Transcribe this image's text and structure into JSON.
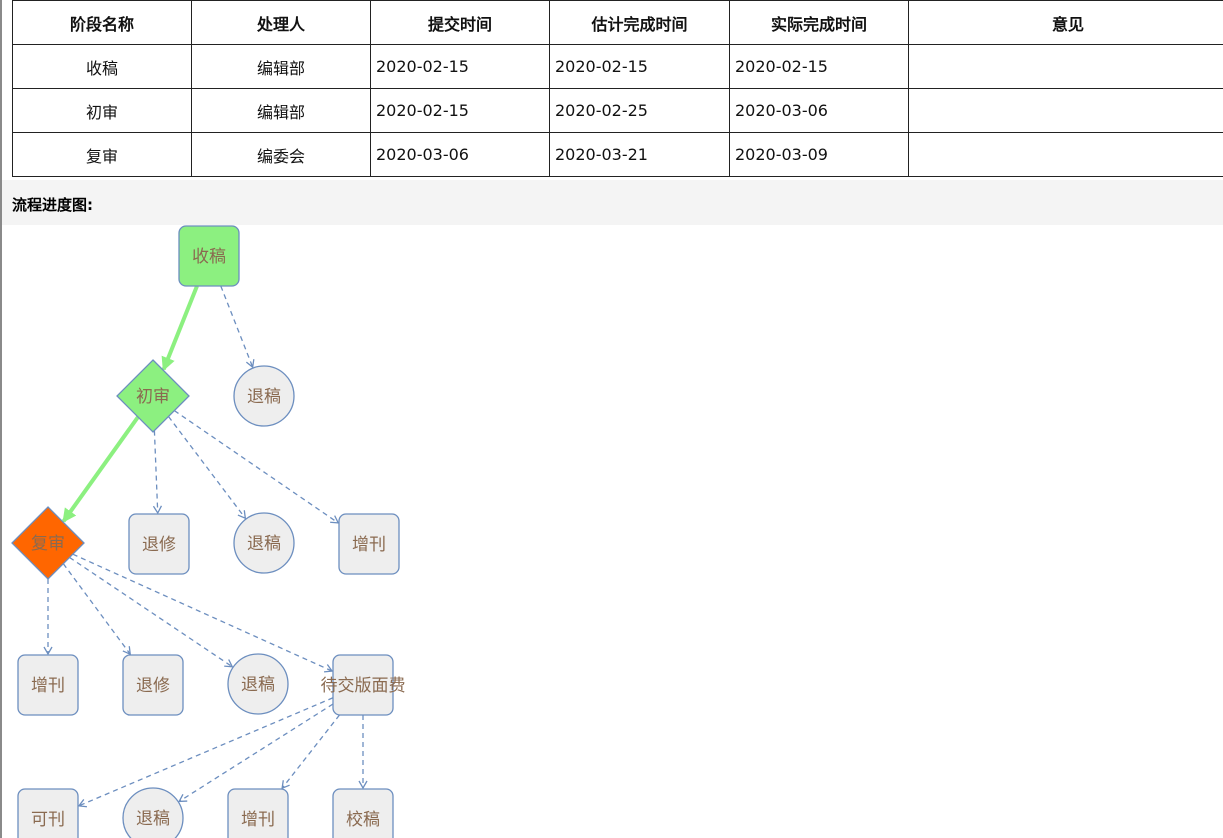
{
  "table": {
    "headers": [
      "阶段名称",
      "处理人",
      "提交时间",
      "估计完成时间",
      "实际完成时间",
      "意见"
    ],
    "rows": [
      {
        "stage": "收稿",
        "handler": "编辑部",
        "submitted": "2020-02-15",
        "estimated": "2020-02-15",
        "actual": "2020-02-15",
        "opinion": ""
      },
      {
        "stage": "初审",
        "handler": "编辑部",
        "submitted": "2020-02-15",
        "estimated": "2020-02-25",
        "actual": "2020-03-06",
        "opinion": ""
      },
      {
        "stage": "复审",
        "handler": "编委会",
        "submitted": "2020-03-06",
        "estimated": "2020-03-21",
        "actual": "2020-03-09",
        "opinion": ""
      }
    ]
  },
  "flow": {
    "title": "流程进度图:",
    "nodes": [
      {
        "id": "shougao",
        "label": "收稿",
        "shape": "rounded-square",
        "status": "done"
      },
      {
        "id": "tuigao1",
        "label": "退稿",
        "shape": "circle",
        "status": "inactive"
      },
      {
        "id": "chushen",
        "label": "初审",
        "shape": "diamond",
        "status": "done"
      },
      {
        "id": "tuixiu1",
        "label": "退修",
        "shape": "rounded-square",
        "status": "inactive"
      },
      {
        "id": "tuigao2",
        "label": "退稿",
        "shape": "circle",
        "status": "inactive"
      },
      {
        "id": "zengkan1",
        "label": "增刊",
        "shape": "rounded-square",
        "status": "inactive"
      },
      {
        "id": "fushen",
        "label": "复审",
        "shape": "diamond",
        "status": "current"
      },
      {
        "id": "zengkan2",
        "label": "增刊",
        "shape": "rounded-square",
        "status": "inactive"
      },
      {
        "id": "tuixiu2",
        "label": "退修",
        "shape": "rounded-square",
        "status": "inactive"
      },
      {
        "id": "tuigao3",
        "label": "退稿",
        "shape": "circle",
        "status": "inactive"
      },
      {
        "id": "daijiao",
        "label": "待交版面费",
        "shape": "rounded-square",
        "status": "inactive"
      },
      {
        "id": "kekan",
        "label": "可刊",
        "shape": "rounded-square",
        "status": "inactive"
      },
      {
        "id": "tuigao4",
        "label": "退稿",
        "shape": "circle",
        "status": "inactive"
      },
      {
        "id": "zengkan3",
        "label": "增刊",
        "shape": "rounded-square",
        "status": "inactive"
      },
      {
        "id": "jiaogao",
        "label": "校稿",
        "shape": "rounded-square",
        "status": "inactive"
      }
    ],
    "edges": [
      {
        "from": "shougao",
        "to": "chushen",
        "style": "completed"
      },
      {
        "from": "shougao",
        "to": "tuigao1",
        "style": "possible"
      },
      {
        "from": "chushen",
        "to": "fushen",
        "style": "completed"
      },
      {
        "from": "chushen",
        "to": "tuixiu1",
        "style": "possible"
      },
      {
        "from": "chushen",
        "to": "tuigao2",
        "style": "possible"
      },
      {
        "from": "chushen",
        "to": "zengkan1",
        "style": "possible"
      },
      {
        "from": "fushen",
        "to": "zengkan2",
        "style": "possible"
      },
      {
        "from": "fushen",
        "to": "tuixiu2",
        "style": "possible"
      },
      {
        "from": "fushen",
        "to": "tuigao3",
        "style": "possible"
      },
      {
        "from": "fushen",
        "to": "daijiao",
        "style": "possible"
      },
      {
        "from": "daijiao",
        "to": "kekan",
        "style": "possible"
      },
      {
        "from": "daijiao",
        "to": "tuigao4",
        "style": "possible"
      },
      {
        "from": "daijiao",
        "to": "zengkan3",
        "style": "possible"
      },
      {
        "from": "daijiao",
        "to": "jiaogao",
        "style": "possible"
      }
    ],
    "colors": {
      "done_fill": "#8cf080",
      "current_fill": "#ff6600",
      "inactive_fill": "#eeeeee",
      "node_stroke": "#6c8ebf",
      "label_text": "#8a6a50",
      "completed_edge": "#8cf080",
      "possible_edge": "#6c8ebf"
    }
  }
}
